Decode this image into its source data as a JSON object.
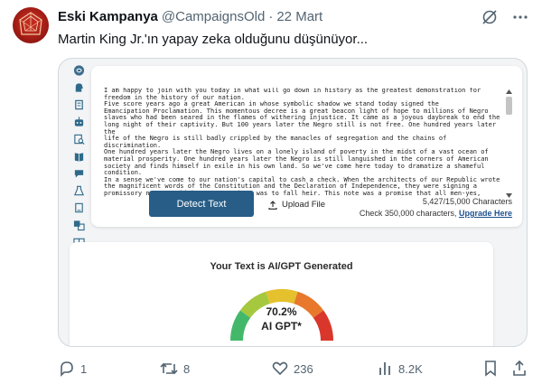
{
  "tweet": {
    "author_name": "Eski Kampanya",
    "handle": "@CampaignsOld",
    "separator": "·",
    "date": "22 Mart",
    "text": "Martin King Jr.'ın yapay zeka olduğunu düşünüyor..."
  },
  "media": {
    "essay_text": "I am happy to join with you today in what will go down in history as the greatest demonstration for\nfreedom in the history of our nation.\nFive score years ago a great American in whose symbolic shadow we stand today signed the\nEmancipation Proclamation. This momentous decree is a great beacon light of hope to millions of Negro\nslaves who had been seared in the flames of withering injustice. It came as a joyous daybreak to end the\nlong night of their captivity. But 100 years later the Negro still is not free. One hundred years later the\nlife of the Negro is still badly crippled by the manacles of segregation and the chains of discrimination.\nOne hundred years later the Negro lives on a lonely island of poverty in the midst of a vast ocean of\nmaterial prosperity. One hundred years later the Negro is still languished in the corners of American\nsociety and finds himself in exile in his own land. So we've come here today to dramatize a shameful\ncondition.\nIn a sense we've come to our nation's capital to cash a check. When the architects of our Republic wrote\nthe magnificent words of the Constitution and the Declaration of Independence, they were signing a\npromissory note to which every American was to fall heir. This note was a promise that all men-yes,",
    "detect_button": "Detect Text",
    "upload_label": "Upload File",
    "char_count": "5,427/15,000 Characters",
    "check_text": "Check 350,000 characters,",
    "upgrade_link": "Upgrade Here",
    "result_title": "Your Text is AI/GPT Generated",
    "percentage": "70.2%",
    "ai_label": "AI GPT*",
    "gauge_value": 0.702,
    "gauge_colors": [
      "#43b86a",
      "#a5c83f",
      "#e5c12e",
      "#e8782c",
      "#d9372b"
    ]
  },
  "actions": {
    "replies": "1",
    "retweets": "8",
    "likes": "236",
    "views": "8.2K"
  },
  "icons": {
    "top": [
      "grok-icon",
      "more-icon"
    ],
    "sidebar": [
      "brain-icon",
      "head-icon",
      "document-icon",
      "robot-icon",
      "search-document-icon",
      "book-icon",
      "chat-icon",
      "flask-icon",
      "paper-icon",
      "translate-icon",
      "columns-icon"
    ],
    "bottom": [
      "reply-icon",
      "retweet-icon",
      "like-icon",
      "views-icon",
      "bookmark-icon",
      "share-icon"
    ]
  }
}
